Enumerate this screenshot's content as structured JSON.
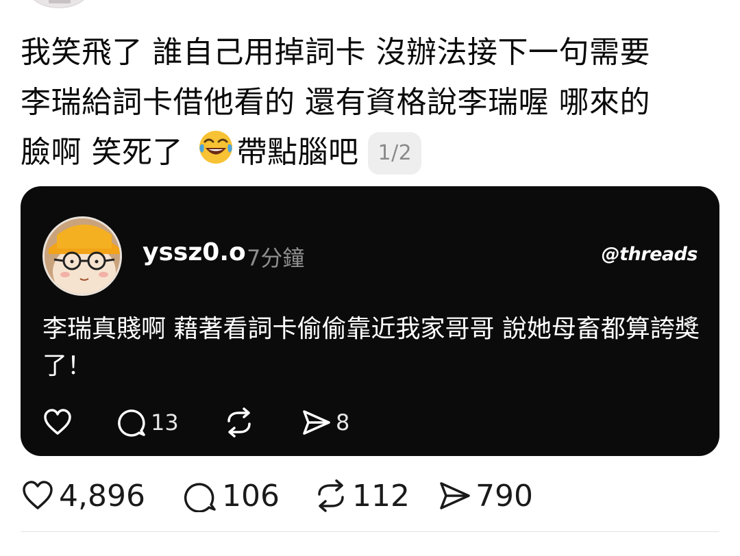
{
  "post": {
    "text_lines": [
      "我笑飛了 誰自己用掉詞卡 沒辦法接下一句需要",
      "李瑞給詞卡借他看的 還有資格說李瑞喔 哪來的",
      "臉啊 笑死了 "
    ],
    "text_after_emoji": "帶點腦吧",
    "emoji": "tears-of-joy-emoji",
    "page_indicator": "1/2"
  },
  "quoted": {
    "username": "yssz0.o",
    "time": "7分鐘",
    "brand": "threads",
    "body": "李瑞真賤啊 藉著看詞卡偷偷靠近我家哥哥 說她母畜都算誇獎了！",
    "stats": {
      "replies": "13",
      "shares": "8"
    }
  },
  "stats": {
    "likes": "4,896",
    "replies": "106",
    "reposts": "112",
    "shares": "790"
  },
  "colors": {
    "card_bg": "#0b0b0b",
    "text": "#0a0a0a",
    "muted": "#8e8e8e",
    "badge_bg": "#eeeeee"
  }
}
